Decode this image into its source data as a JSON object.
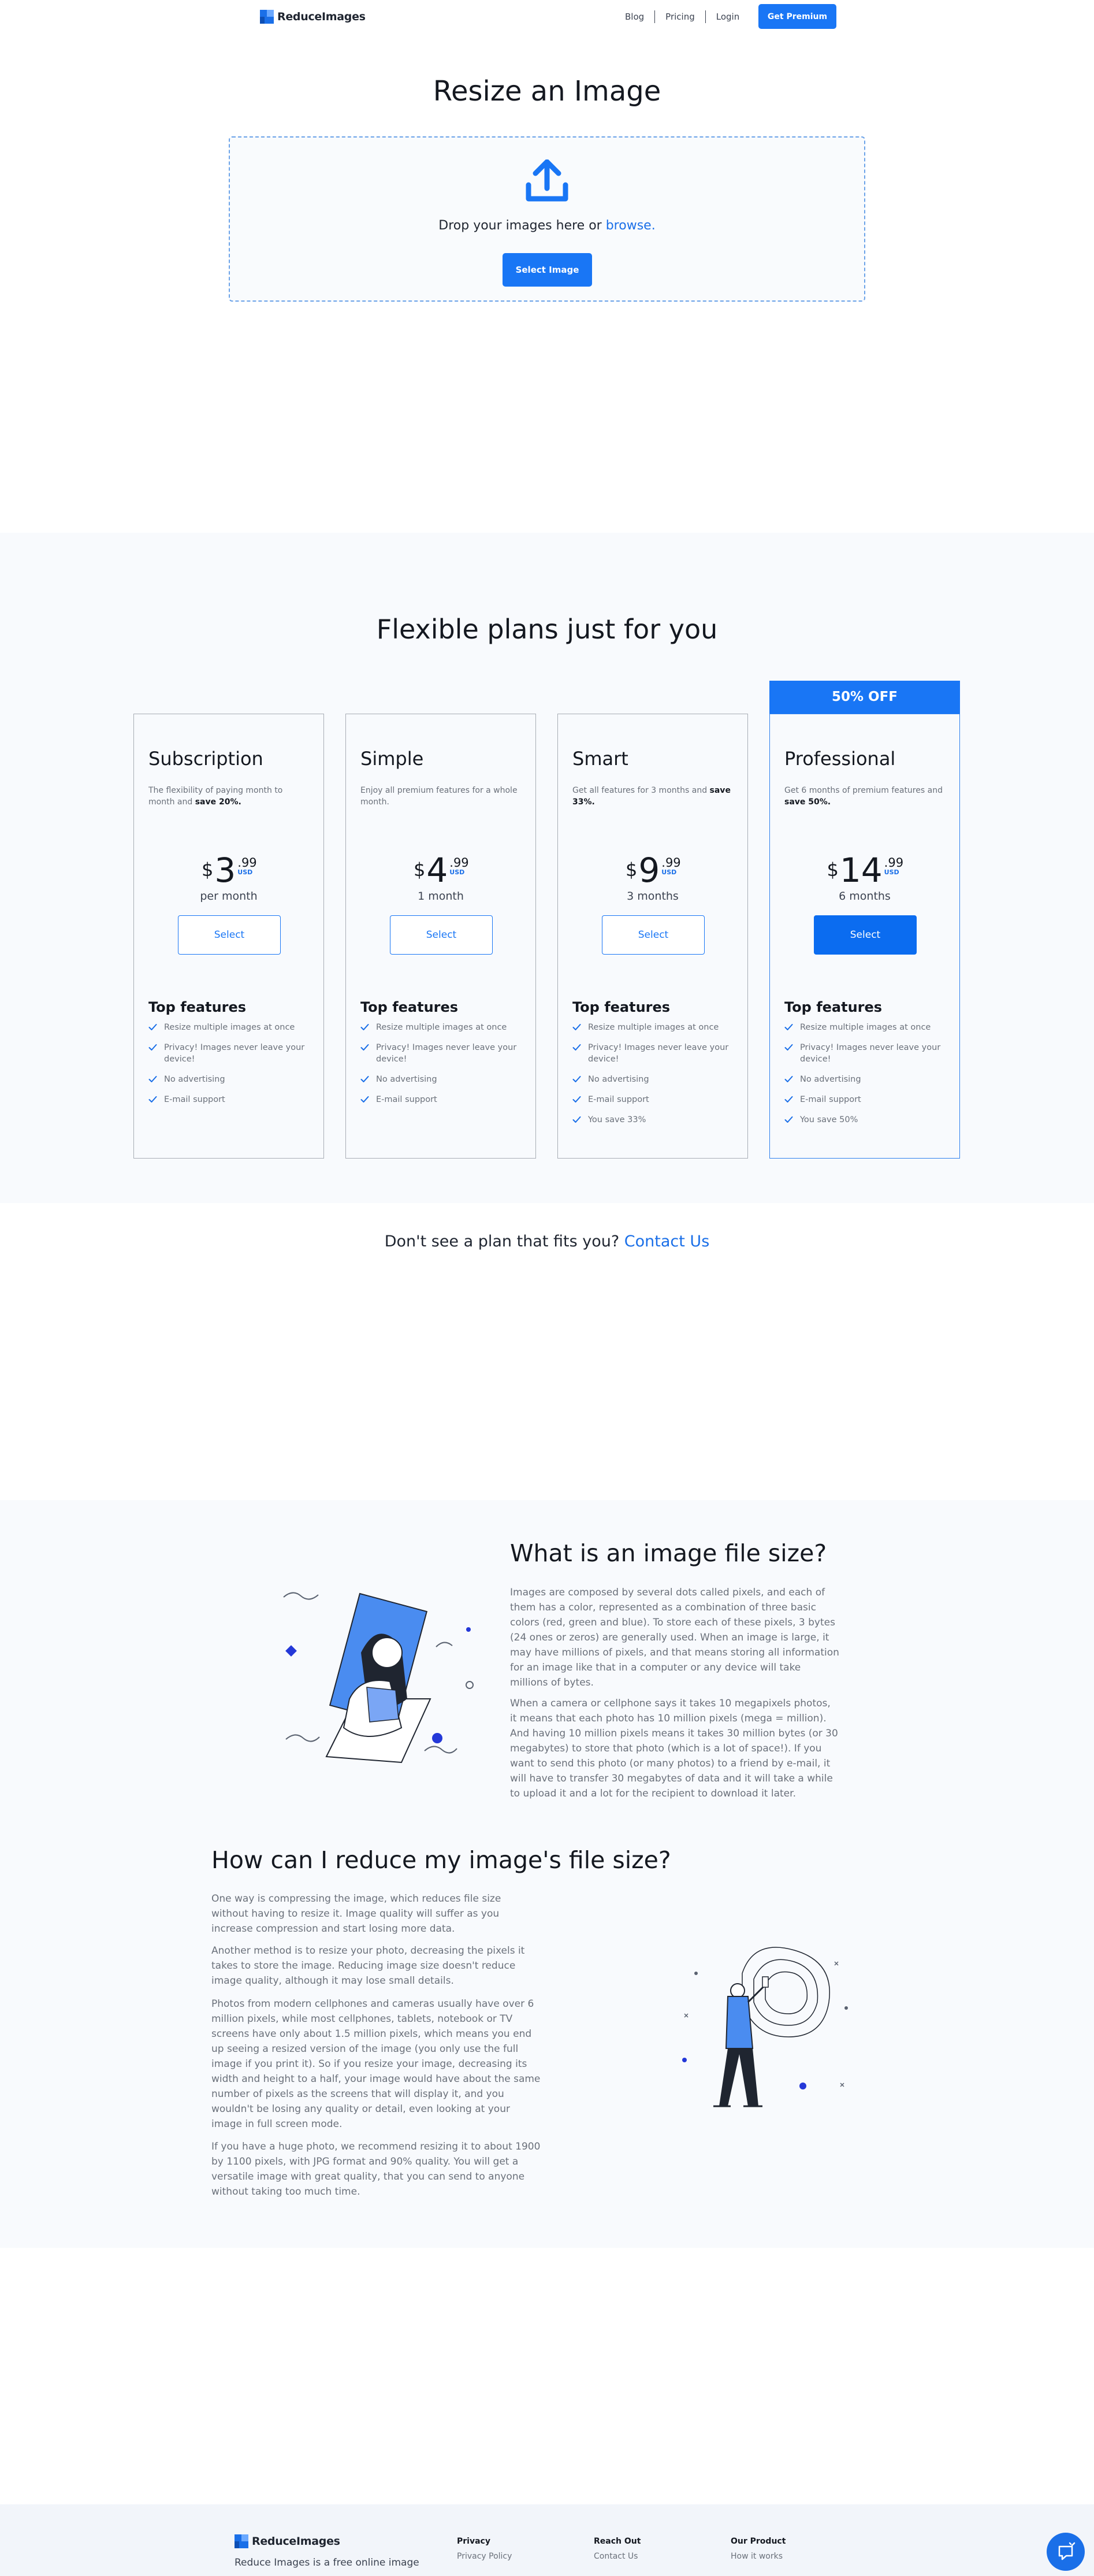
{
  "nav": {
    "logo_text": "ReduceImages",
    "links": [
      "Blog",
      "Pricing",
      "Login"
    ],
    "premium_label": "Get Premium"
  },
  "hero": {
    "title": "Resize an Image",
    "drop_text": "Drop your images here or ",
    "browse_text": "browse.",
    "select_label": "Select Image"
  },
  "pricing": {
    "title": "Flexible plans just for you",
    "discount_banner": "50% OFF",
    "currency_symbol": "$",
    "currency_code": "USD",
    "features_title": "Top features",
    "plans": [
      {
        "name": "Subscription",
        "desc_plain": "The flexibility of paying month to month and ",
        "desc_bold": "save 20%.",
        "amount": "3",
        "cents": ".99",
        "period": "per month",
        "button": "Select",
        "features": [
          "Resize multiple images at once",
          "Privacy! Images never leave your device!",
          "No advertising",
          "E-mail support"
        ]
      },
      {
        "name": "Simple",
        "desc_plain": "Enjoy all premium features for a whole month.",
        "desc_bold": "",
        "amount": "4",
        "cents": ".99",
        "period": "1 month",
        "button": "Select",
        "features": [
          "Resize multiple images at once",
          "Privacy! Images never leave your device!",
          "No advertising",
          "E-mail support"
        ]
      },
      {
        "name": "Smart",
        "desc_plain": "Get all features for 3 months and ",
        "desc_bold": "save 33%.",
        "amount": "9",
        "cents": ".99",
        "period": "3 months",
        "button": "Select",
        "features": [
          "Resize multiple images at once",
          "Privacy! Images never leave your device!",
          "No advertising",
          "E-mail support",
          "You save 33%"
        ]
      },
      {
        "name": "Professional",
        "desc_plain": "Get 6 months of premium features and ",
        "desc_bold": "save 50%.",
        "amount": "14",
        "cents": ".99",
        "period": "6 months",
        "button": "Select",
        "features": [
          "Resize multiple images at once",
          "Privacy! Images never leave your device!",
          "No advertising",
          "E-mail support",
          "You save 50%"
        ]
      }
    ],
    "cta_text": "Don't see a plan that fits you? ",
    "cta_link": "Contact Us"
  },
  "info": {
    "q1_title": "What is an image file size?",
    "q1_paragraphs": [
      "Images are composed by several dots called pixels, and each of them has a color, represented as a combination of three basic colors (red, green and blue). To store each of these pixels, 3 bytes (24 ones or zeros) are generally used. When an image is large, it may have millions of pixels, and that means storing all information for an image like that in a computer or any device will take millions of bytes.",
      "When a camera or cellphone says it takes 10 megapixels photos, it means that each photo has 10 million pixels (mega = million). And having 10 million pixels means it takes 30 million bytes (or 30 megabytes) to store that photo (which is a lot of space!). If you want to send this photo (or many photos) to a friend by e-mail, it will have to transfer 30 megabytes of data and it will take a while to upload it and a lot for the recipient to download it later."
    ],
    "q2_title": "How can I reduce my image's file size?",
    "q2_paragraphs": [
      "One way is compressing the image, which reduces file size without having to resize it. Image quality will suffer as you increase compression and start losing more data.",
      "Another method is to resize your photo, decreasing the pixels it takes to store the image. Reducing image size doesn't reduce image quality, although it may lose small details.",
      "Photos from modern cellphones and cameras usually have over 6 million pixels, while most cellphones, tablets, notebook or TV screens have only about 1.5 million pixels, which means you end up seeing a resized version of the image (you only use the full image if you print it). So if you resize your image, decreasing its width and height to a half, your image would have about the same number of pixels as the screens that will display it, and you wouldn't be losing any quality or detail, even looking at your image in full screen mode.",
      "If you have a huge photo, we recommend resizing it to about 1900 by 1100 pixels, with JPG format and 90% quality. You will get a versatile image with great quality, that you can send to anyone without taking too much time."
    ]
  },
  "footer": {
    "logo_text": "ReduceImages",
    "tagline": "Reduce Images is a free online image",
    "columns": [
      {
        "title": "Privacy",
        "links": [
          "Privacy Policy"
        ]
      },
      {
        "title": "Reach Out",
        "links": [
          "Contact Us"
        ]
      },
      {
        "title": "Our Product",
        "links": [
          "How it works"
        ]
      }
    ]
  },
  "colors": {
    "accent": "#1976f5",
    "link": "#1a6fe8",
    "section_bg": "#f8fafd"
  }
}
